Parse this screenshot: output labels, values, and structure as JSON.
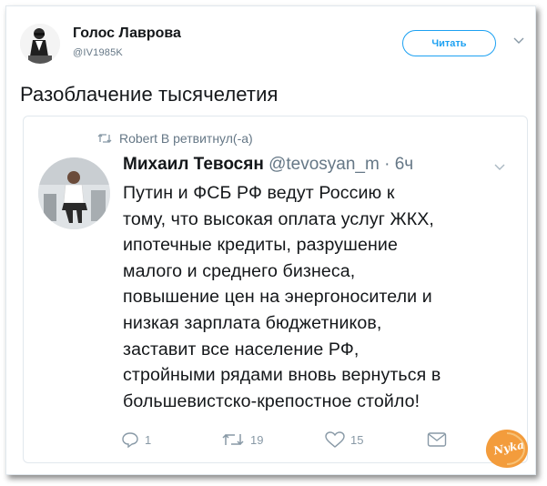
{
  "tweet": {
    "author_name": "Голос Лаврова",
    "author_handle": "@IV1985K",
    "follow_label": "Читать",
    "text": "Разоблачение тысячелетия"
  },
  "quote": {
    "retweet_line": "Robert B ретвитнул(-а)",
    "author_name": "Михаил Тевосян",
    "author_meta": "@tevosyan_m · 6ч",
    "body_lines": [
      "Путин и ФСБ РФ ведут Россию к",
      "тому, что высокая оплата услуг ЖКХ,",
      "ипотечные кредиты, разрушение",
      "малого и среднего бизнеса,",
      "повышение цен на энергоносители и",
      "низкая зарплата бюджетников,",
      "заставит все население РФ,",
      "стройными рядами вновь вернуться в",
      "большевистско-крепостное стойло!"
    ],
    "actions": {
      "reply_count": "1",
      "retweet_count": "19",
      "like_count": "15"
    }
  },
  "watermark": {
    "text": "Nyka"
  },
  "icons": {
    "caret": "chevron-down-icon",
    "retweet": "retweet-icon",
    "reply": "reply-icon",
    "like": "heart-icon",
    "dm": "envelope-icon"
  },
  "colors": {
    "accent": "#1da1f2",
    "muted": "#657786",
    "action": "#8899a6",
    "border": "#e1e8ed",
    "watermark": "#f39c3c"
  }
}
